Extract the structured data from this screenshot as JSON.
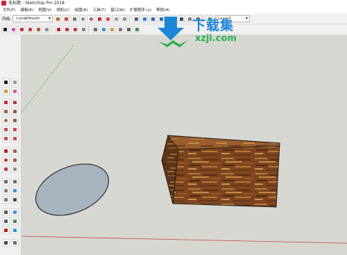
{
  "window": {
    "title": "无标题 - SketchUp Pro 2018"
  },
  "menu": [
    "文件(F)",
    "编辑(E)",
    "视图(V)",
    "相机(C)",
    "绘图(R)",
    "工具(T)",
    "窗口(W)",
    "扩展程序 (x)",
    "帮助(H)"
  ],
  "toolbar": {
    "style_label": "风格:",
    "style_value": "<undefined>",
    "layer_value": "Layer0"
  },
  "watermark": {
    "text": "下载集",
    "url": "xzji.com"
  },
  "colors": {
    "wood_top": "#a0632e",
    "wood_front": "#7d4520",
    "wood_side": "#5c3418",
    "circle_fill": "#a7b4bf",
    "viewport_bg": "#d7d7d2"
  }
}
